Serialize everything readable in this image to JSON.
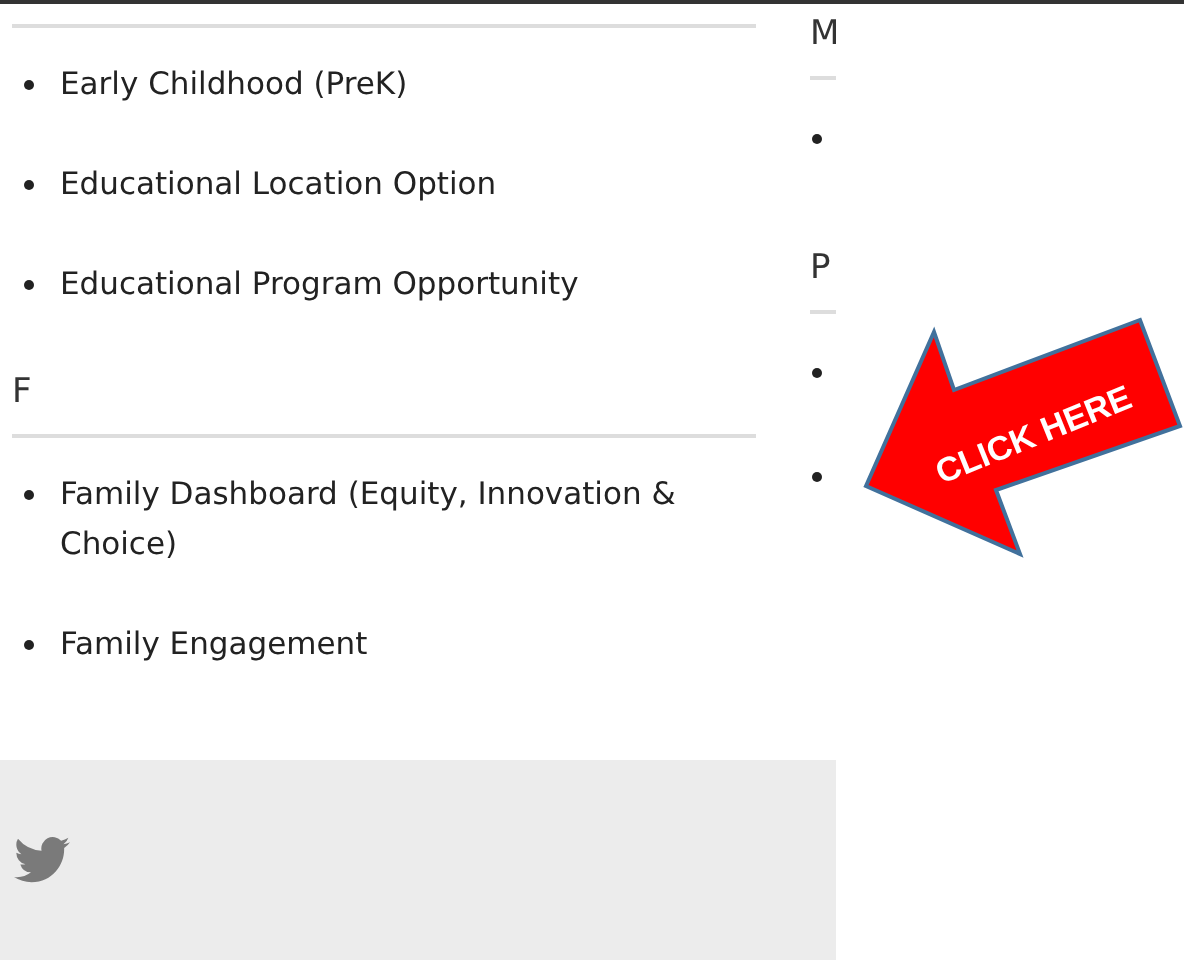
{
  "left_sections": [
    {
      "items": [
        "Early Childhood (PreK)",
        "Educational Location Option",
        "Educational Program Opportunity"
      ]
    },
    {
      "heading": "F",
      "items": [
        "Family Dashboard (Equity, Innovation & Choice)",
        "Family Engagement"
      ]
    }
  ],
  "right_sections": [
    {
      "heading": "M",
      "items": [
        {
          "kind": "bullet"
        }
      ]
    },
    {
      "heading": "P",
      "items": [
        {
          "kind": "bullet"
        },
        {
          "kind": "bullet"
        }
      ]
    }
  ],
  "callout": {
    "label": "CLICK HERE"
  },
  "footer": {
    "icons": [
      {
        "kind": "twitter"
      }
    ]
  }
}
